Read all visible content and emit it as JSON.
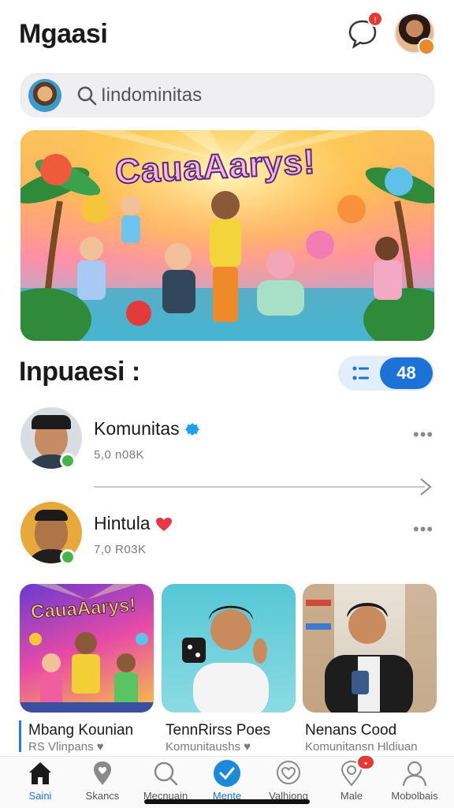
{
  "header": {
    "title": "Mgaasi",
    "chat_badge": "!",
    "icons": [
      "chat-bubble-icon",
      "profile-avatar"
    ]
  },
  "search": {
    "placeholder": "Iindominitas"
  },
  "hero": {
    "title": "CauaAarys!"
  },
  "section": {
    "title": "Inpuaesi :",
    "count": "48"
  },
  "list": [
    {
      "name": "Komunitas",
      "sub": "5,0 n08K",
      "badge": "verified-badge-icon"
    },
    {
      "name": "Hintula",
      "sub": "7,0 R03K",
      "badge": "heart-icon"
    }
  ],
  "cards": [
    {
      "title": "Mbang Kounian",
      "sub": "RS Vlinpans ♥",
      "banner": "CauaAarys!"
    },
    {
      "title": "TennRirss Poes",
      "sub": "Komunitaushs ♥"
    },
    {
      "title": "Nenans Cood",
      "sub": "Komunitansn Hldiuan"
    }
  ],
  "tabs": [
    {
      "label": "Saini",
      "icon": "home-icon"
    },
    {
      "label": "Skancs",
      "icon": "location-icon"
    },
    {
      "label": "Mecnuain",
      "icon": "search-icon"
    },
    {
      "label": "Mente",
      "icon": "check-icon"
    },
    {
      "label": "Valhiong",
      "icon": "heart-icon"
    },
    {
      "label": "Male",
      "icon": "location-heart-icon",
      "badge": "•"
    },
    {
      "label": "Mobolbais",
      "icon": "person-icon"
    }
  ],
  "colors": {
    "accent": "#1c72d7",
    "badge": "#e53935",
    "online": "#44b549"
  }
}
